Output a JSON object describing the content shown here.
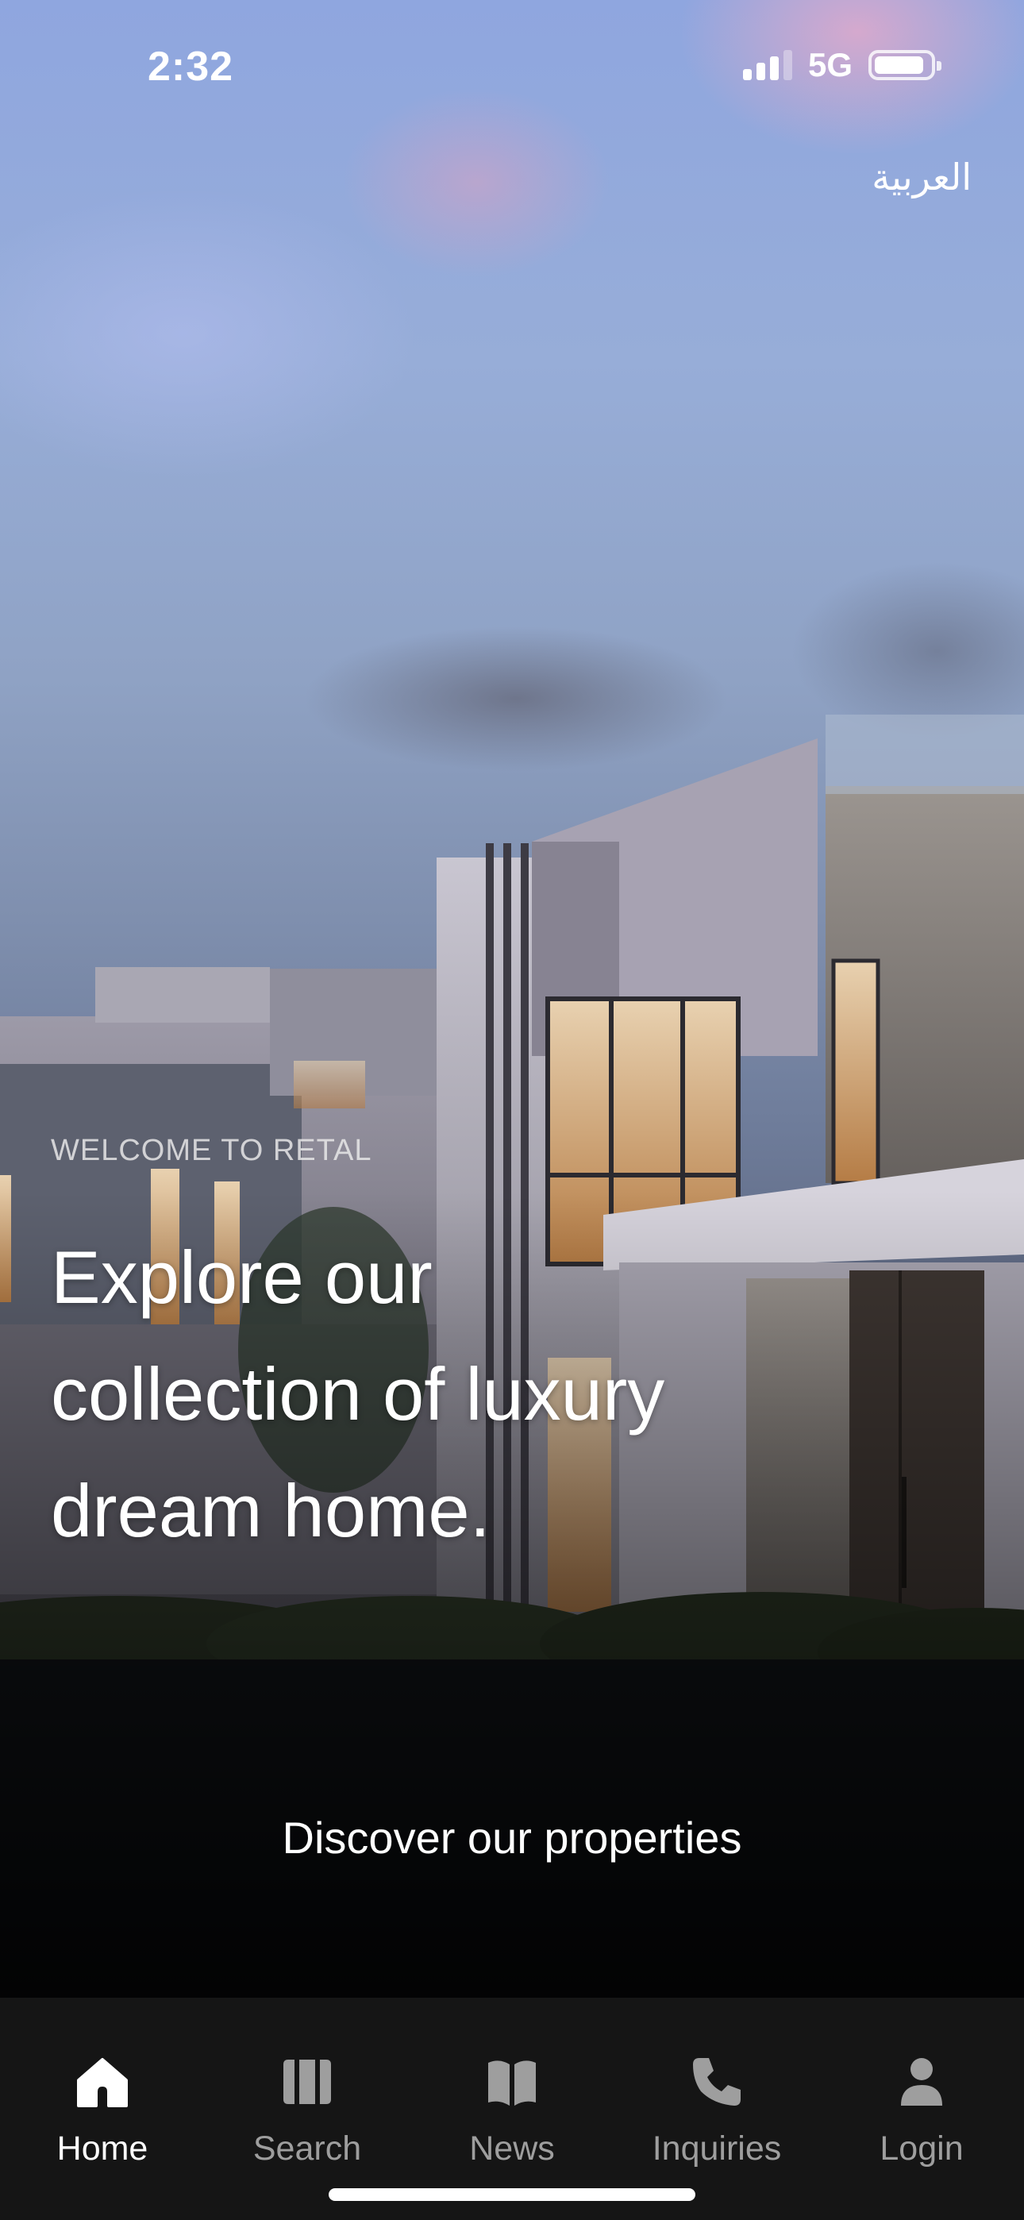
{
  "status_bar": {
    "time": "2:32",
    "network": "5G",
    "signal_bars": 3,
    "signal_max": 4,
    "battery_level": 0.9
  },
  "header": {
    "language_toggle": "العربية"
  },
  "hero": {
    "eyebrow": "WELCOME TO RETAL",
    "headline_lines": [
      "Explore our",
      "collection of luxury",
      "dream home."
    ],
    "cta": "Discover our properties"
  },
  "tabs": [
    {
      "label": "Home",
      "icon": "home-icon",
      "active": true
    },
    {
      "label": "Search",
      "icon": "map-icon",
      "active": false
    },
    {
      "label": "News",
      "icon": "book-icon",
      "active": false
    },
    {
      "label": "Inquiries",
      "icon": "phone-icon",
      "active": false
    },
    {
      "label": "Login",
      "icon": "user-icon",
      "active": false
    }
  ],
  "colors": {
    "tab_bar_background": "#151515",
    "tab_active": "#ffffff",
    "tab_inactive": "#9e9e9e"
  }
}
